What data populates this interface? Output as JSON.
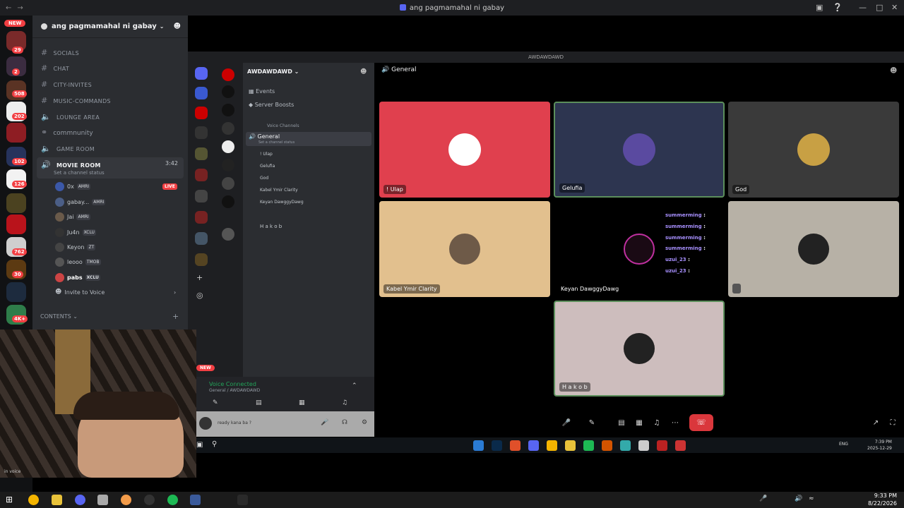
{
  "window": {
    "title": "ang pagmamahal ni gabay"
  },
  "rail": {
    "new_badge": "NEW",
    "badges": [
      "29",
      "2",
      "508",
      "202",
      "102",
      "126",
      "762",
      "30",
      "4K+"
    ]
  },
  "sidebar": {
    "server_name": "ang pagmamahal ni gabay",
    "channels": [
      {
        "type": "text",
        "name": "SOCIALS"
      },
      {
        "type": "text",
        "name": "CHAT"
      },
      {
        "type": "text",
        "name": "CITY-INVITES"
      },
      {
        "type": "text",
        "name": "MUSIC-COMMANDS"
      },
      {
        "type": "voice",
        "name": "LOUNGE AREA"
      },
      {
        "type": "forum",
        "name": "commnunity"
      },
      {
        "type": "voice",
        "name": "GAME ROOM"
      },
      {
        "type": "voice",
        "name": "MOVIE ROOM"
      }
    ],
    "movie_room": {
      "timer": "3:42",
      "status": "Set a channel status"
    },
    "voice_users": [
      {
        "name": "0x",
        "tag": "AMRI",
        "live": "LIVE"
      },
      {
        "name": "gabay...",
        "tag": "AMRI"
      },
      {
        "name": "Jai",
        "tag": "AMRI"
      },
      {
        "name": "Ju4n",
        "tag": "XCLU"
      },
      {
        "name": "Keyon",
        "tag": "ZT"
      },
      {
        "name": "leooo",
        "tag": "TMOB"
      },
      {
        "name": "pabs",
        "tag": "XCLU"
      }
    ],
    "invite": "Invite to Voice",
    "category": "CONTENTS"
  },
  "stream": {
    "window_title": "AWDAWDAWD",
    "server_name": "AWDAWDAWD",
    "channel_header": "General",
    "menu": [
      "Events",
      "Server Boosts"
    ],
    "voice_category": "Voice Channels",
    "voice_channel": "General",
    "voice_channel_status": "Set a channel status",
    "members": [
      {
        "name": "! Ulap"
      },
      {
        "name": "Gelufia"
      },
      {
        "name": "God"
      },
      {
        "name": "Kabel Ymir Clarity"
      },
      {
        "name": "Keyan DawggyDawg"
      },
      {
        "name": ""
      },
      {
        "name": "H a k o b"
      }
    ],
    "voice_connected": "Voice Connected",
    "voice_connected_sub": "General / AWDAWDAWD",
    "status_text": "ready kana ba ?",
    "new_badge": "NEW",
    "tiles": [
      {
        "name": "! Ulap",
        "color": "#e0404e"
      },
      {
        "name": "Gelufia",
        "color": "#2d3550"
      },
      {
        "name": "God",
        "color": "#3a3a3a"
      },
      {
        "name": "Kabel Ymir Clarity",
        "color": "#e2c08e"
      },
      {
        "name": "Keyan DawggyDawg",
        "color": "#000000"
      },
      {
        "name": "",
        "color": "#b7b1a6"
      },
      {
        "name": "H a k o b",
        "color": "#cdbdbd"
      }
    ],
    "chat_overlay": [
      {
        "user": "summerming",
        "sep": ":"
      },
      {
        "user": "summerming",
        "sep": ":"
      },
      {
        "user": "summerming",
        "sep": ":"
      },
      {
        "user": "summerming",
        "sep": ":"
      },
      {
        "user": "uzui_23",
        "sep": ":"
      },
      {
        "user": "uzui_23",
        "sep": ":"
      }
    ],
    "inner_clock": {
      "time": "7:39 PM",
      "date": "2025-12-29",
      "lang": "ENG"
    }
  },
  "webcam": {
    "caption": "in voice"
  },
  "taskbar": {
    "time": "9:33 PM",
    "date": "8/22/2026"
  }
}
